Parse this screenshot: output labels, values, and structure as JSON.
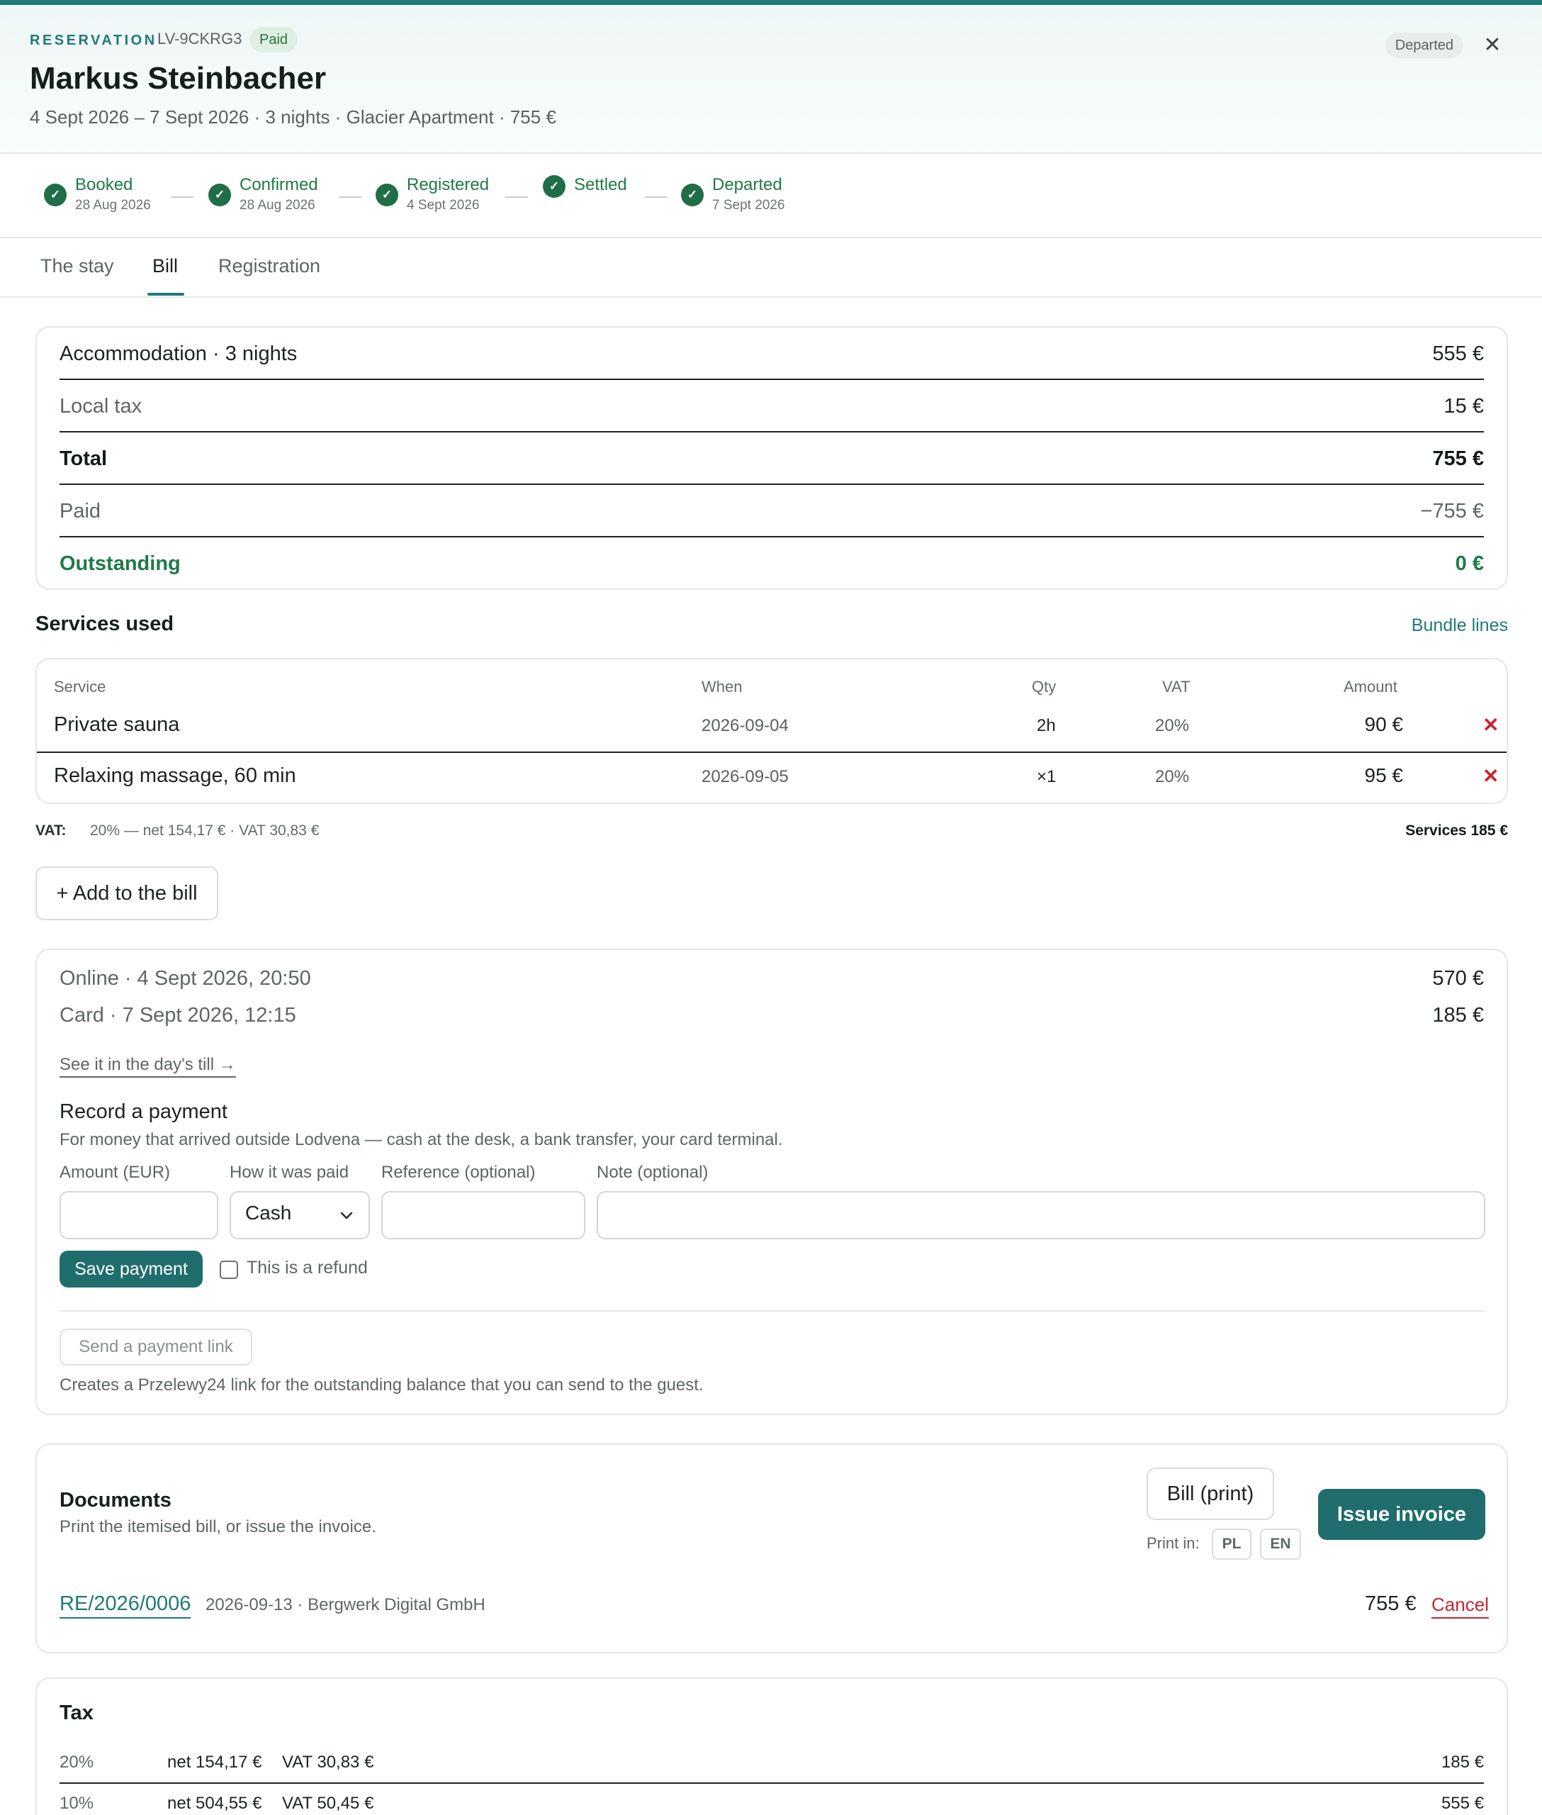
{
  "header": {
    "eyebrow": "RESERVATION",
    "reservation_id": "LV-9CKRG3",
    "payment_badge": "Paid",
    "status_badge": "Departed",
    "close_glyph": "✕",
    "guest_name": "Markus Steinbacher",
    "summary": "4 Sept 2026 – 7 Sept 2026 · 3 nights · Glacier Apartment · 755 €"
  },
  "steps": [
    {
      "label": "Booked",
      "date": "28 Aug 2026"
    },
    {
      "label": "Confirmed",
      "date": "28 Aug 2026"
    },
    {
      "label": "Registered",
      "date": "4 Sept 2026"
    },
    {
      "label": "Settled",
      "date": ""
    },
    {
      "label": "Departed",
      "date": "7 Sept 2026"
    }
  ],
  "check_glyph": "✓",
  "tabs": [
    {
      "label": "The stay",
      "active": false
    },
    {
      "label": "Bill",
      "active": true
    },
    {
      "label": "Registration",
      "active": false
    }
  ],
  "summary": {
    "rows": [
      {
        "label": "Accommodation · 3 nights",
        "value": "555 €"
      },
      {
        "label": "Local tax",
        "value": "15 €"
      },
      {
        "label": "Total",
        "value": "755 €"
      },
      {
        "label": "Paid",
        "value": "−755 €"
      },
      {
        "label": "Outstanding",
        "value": "0 €"
      }
    ]
  },
  "services": {
    "title": "Services used",
    "bundle_link": "Bundle lines",
    "columns": {
      "service": "Service",
      "when": "When",
      "qty": "Qty",
      "vat": "VAT",
      "amount": "Amount"
    },
    "rows": [
      {
        "service": "Private sauna",
        "when": "2026-09-04",
        "qty": "2h",
        "vat": "20%",
        "amount": "90 €"
      },
      {
        "service": "Relaxing massage, 60 min",
        "when": "2026-09-05",
        "qty": "×1",
        "vat": "20%",
        "amount": "95 €"
      }
    ],
    "remove_glyph": "✕",
    "vat_label": "VAT:",
    "vat_summary": "20% — net 154,17 € · VAT 30,83 €",
    "services_total": "Services 185 €",
    "add_button": "+ Add to the bill"
  },
  "payments": {
    "rows": [
      {
        "label": "Online · 4 Sept 2026, 20:50",
        "value": "570 €"
      },
      {
        "label": "Card · 7 Sept 2026, 12:15",
        "value": "185 €"
      }
    ],
    "till_link": "See it in the day's till →",
    "record_title": "Record a payment",
    "record_desc": "For money that arrived outside Lodvena — cash at the desk, a bank transfer, your card terminal.",
    "fields": {
      "amount_label": "Amount (EUR)",
      "amount_value": "",
      "method_label": "How it was paid",
      "method_value": "Cash",
      "reference_label": "Reference (optional)",
      "reference_value": "",
      "note_label": "Note (optional)",
      "note_value": ""
    },
    "save_button": "Save payment",
    "refund_label": "This is a refund",
    "refund_checked": false,
    "send_link_button": "Send a payment link",
    "send_link_desc": "Creates a Przelewy24 link for the outstanding balance that you can send to the guest."
  },
  "documents": {
    "title": "Documents",
    "desc": "Print the itemised bill, or issue the invoice.",
    "bill_button": "Bill (print)",
    "issue_button": "Issue invoice",
    "print_in_label": "Print in:",
    "languages": [
      "PL",
      "EN"
    ],
    "invoice": {
      "number": "RE/2026/0006",
      "meta": "2026-09-13 · Bergwerk Digital GmbH",
      "amount": "755 €",
      "cancel": "Cancel"
    }
  },
  "tax": {
    "title": "Tax",
    "rows": [
      {
        "rate": "20%",
        "net": "net 154,17 €",
        "vat": "VAT 30,83 €",
        "gross": "185 €"
      },
      {
        "rate": "10%",
        "net": "net 504,55 €",
        "vat": "VAT 50,45 €",
        "gross": "555 €"
      }
    ]
  },
  "colors": {
    "accent": "#1f7a76",
    "success": "#1f7a46",
    "danger": "#c6262e",
    "primary_button": "#1f6e6d"
  },
  "icons": {
    "close": "close-icon",
    "check": "check-icon",
    "remove": "remove-icon",
    "dropdown": "chevron-down-icon"
  }
}
